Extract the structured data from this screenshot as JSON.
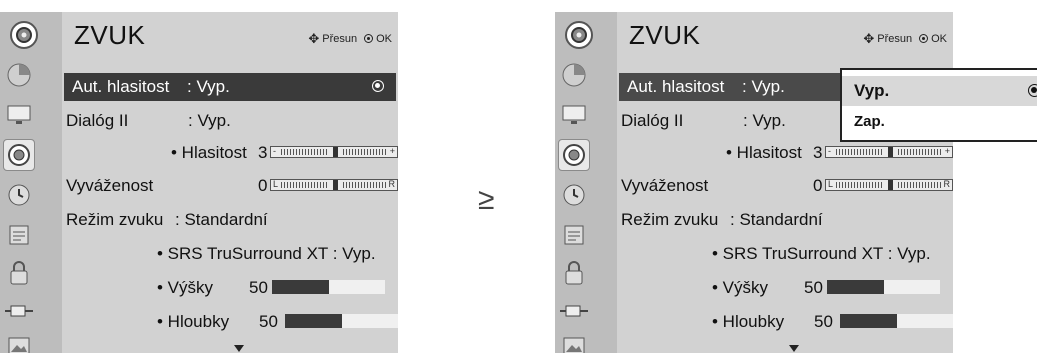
{
  "menu": {
    "title": "ZVUK",
    "hint_move": "Přesun",
    "hint_ok": "OK"
  },
  "sidebar": {
    "icons": [
      "sound-icon",
      "picture-icon",
      "screen-icon",
      "sound-icon",
      "clock-icon",
      "option-icon",
      "lock-icon",
      "input-icon",
      "photo-icon"
    ]
  },
  "rows": {
    "auto_volume": {
      "label": "Aut. hlasitost",
      "value": ": Vyp."
    },
    "dialog": {
      "label": "Dialóg II",
      "value": ": Vyp."
    },
    "volume": {
      "label": "• Hlasitost",
      "value": "3",
      "end_l": "-",
      "end_r": "+",
      "level": 0.5
    },
    "balance": {
      "label": "Vyváženost",
      "value": "0",
      "end_l": "L",
      "end_r": "R",
      "level": 0.5
    },
    "sound_mode": {
      "label": "Režim zvuku",
      "value": ": Standardní"
    },
    "srs": {
      "label": "• SRS TruSurround XT : Vyp."
    },
    "treble": {
      "label": "• Výšky",
      "value": "50",
      "level": 0.5
    },
    "bass": {
      "label": "• Hloubky",
      "value": "50",
      "level": 0.5
    }
  },
  "dropdown": {
    "options": [
      "Vyp.",
      "Zap."
    ],
    "selected": "Vyp."
  },
  "transition_symbol": "≥",
  "colors": {
    "panel_bg": "#d2d2d2",
    "sidebar_bg": "#bdbdbd",
    "highlight": "#3a3a3a",
    "bar_fill": "#3a3a3a"
  }
}
